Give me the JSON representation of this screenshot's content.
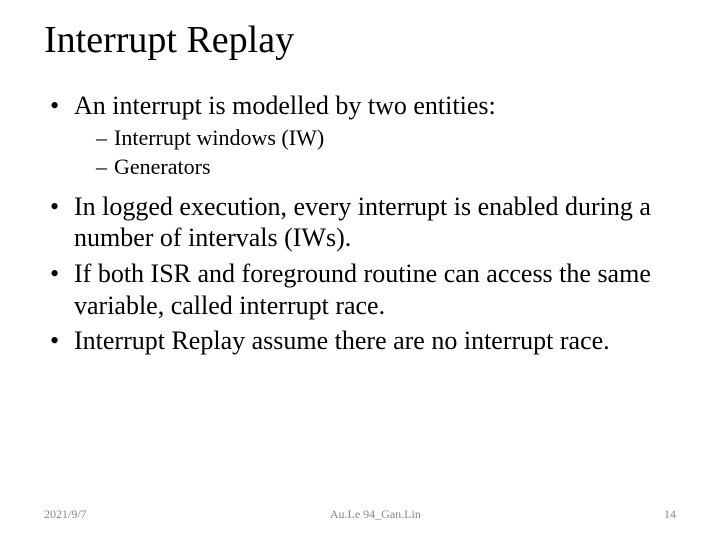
{
  "title": "Interrupt Replay",
  "bullets": {
    "b1": "An interrupt is modelled by two entities:",
    "b1_sub": {
      "s1": "Interrupt windows (IW)",
      "s2": "Generators"
    },
    "b2": "In logged execution, every interrupt is enabled during a number of intervals (IWs).",
    "b3": "If both ISR and foreground routine can access the same variable, called interrupt race.",
    "b4": "Interrupt Replay assume there are no interrupt race."
  },
  "footer": {
    "date": "2021/9/7",
    "center": "Au.Le 94_Gan.Lin",
    "page": "14"
  }
}
